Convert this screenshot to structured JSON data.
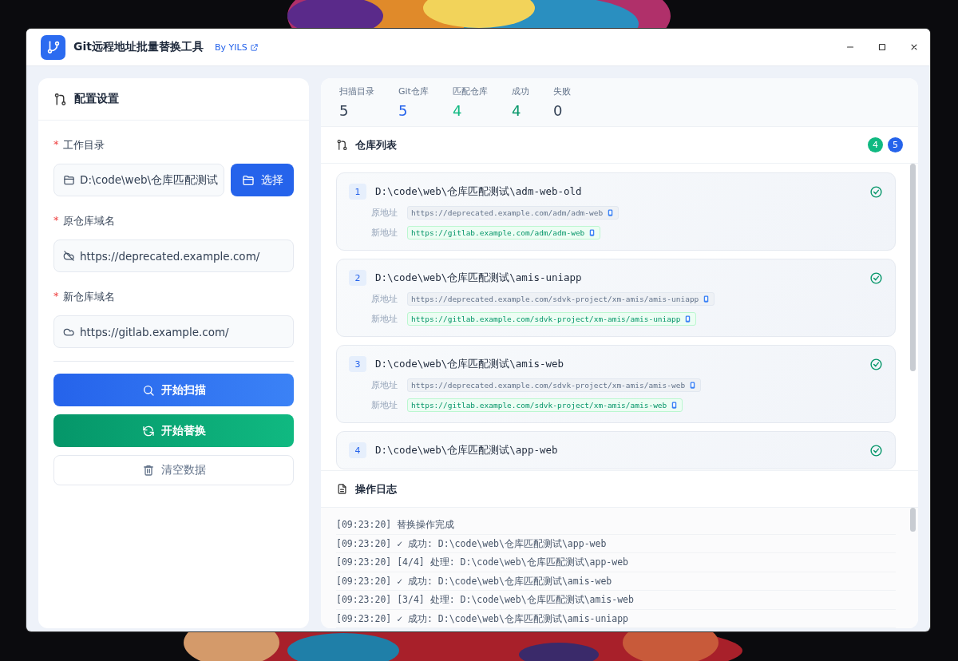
{
  "window": {
    "title": "Git远程地址批量替换工具",
    "author_link": "By YILS"
  },
  "config": {
    "title": "配置设置",
    "fields": [
      {
        "label": "工作目录",
        "marker": "*",
        "value": "D:\\code\\web\\仓库匹配测试",
        "button": "选择"
      },
      {
        "label": "原仓库域名",
        "marker": "*",
        "value": "https://deprecated.example.com/"
      },
      {
        "label": "新仓库域名",
        "marker": "*",
        "value": "https://gitlab.example.com/"
      }
    ],
    "buttons": [
      {
        "label": "开始扫描",
        "kind": "primary"
      },
      {
        "label": "开始替换",
        "kind": "success"
      },
      {
        "label": "清空数据",
        "kind": "plain"
      }
    ]
  },
  "stats": [
    {
      "label": "扫描目录",
      "value": "5",
      "color": "#334155"
    },
    {
      "label": "Git仓库",
      "value": "5",
      "color": "#2563eb"
    },
    {
      "label": "匹配仓库",
      "value": "4",
      "color": "#10b981"
    },
    {
      "label": "成功",
      "value": "4",
      "color": "#059669"
    },
    {
      "label": "失败",
      "value": "0",
      "color": "#334155"
    }
  ],
  "repo_list": {
    "title": "仓库列表",
    "badges": [
      {
        "text": "4",
        "color": "#10b981"
      },
      {
        "text": "5",
        "color": "#2563eb"
      }
    ],
    "repos": [
      {
        "index": "1",
        "path": "D:\\code\\web\\仓库匹配测试\\adm-web-old",
        "success": true,
        "old_label": "原地址",
        "old_url": "https://deprecated.example.com/adm/adm-web",
        "new_label": "新地址",
        "new_url": "https://gitlab.example.com/adm/adm-web"
      },
      {
        "index": "2",
        "path": "D:\\code\\web\\仓库匹配测试\\amis-uniapp",
        "success": true,
        "old_label": "原地址",
        "old_url": "https://deprecated.example.com/sdvk-project/xm-amis/amis-uniapp",
        "new_label": "新地址",
        "new_url": "https://gitlab.example.com/sdvk-project/xm-amis/amis-uniapp"
      },
      {
        "index": "3",
        "path": "D:\\code\\web\\仓库匹配测试\\amis-web",
        "success": true,
        "old_label": "原地址",
        "old_url": "https://deprecated.example.com/sdvk-project/xm-amis/amis-web",
        "new_label": "新地址",
        "new_url": "https://gitlab.example.com/sdvk-project/xm-amis/amis-web"
      },
      {
        "index": "4",
        "path": "D:\\code\\web\\仓库匹配测试\\app-web",
        "success": true
      }
    ]
  },
  "log": {
    "title": "操作日志",
    "lines": [
      "[09:23:20] 替换操作完成",
      "[09:23:20] ✓ 成功: D:\\code\\web\\仓库匹配测试\\app-web",
      "[09:23:20] [4/4] 处理: D:\\code\\web\\仓库匹配测试\\app-web",
      "[09:23:20] ✓ 成功: D:\\code\\web\\仓库匹配测试\\amis-web",
      "[09:23:20] [3/4] 处理: D:\\code\\web\\仓库匹配测试\\amis-web",
      "[09:23:20] ✓ 成功: D:\\code\\web\\仓库匹配测试\\amis-uniapp"
    ]
  }
}
